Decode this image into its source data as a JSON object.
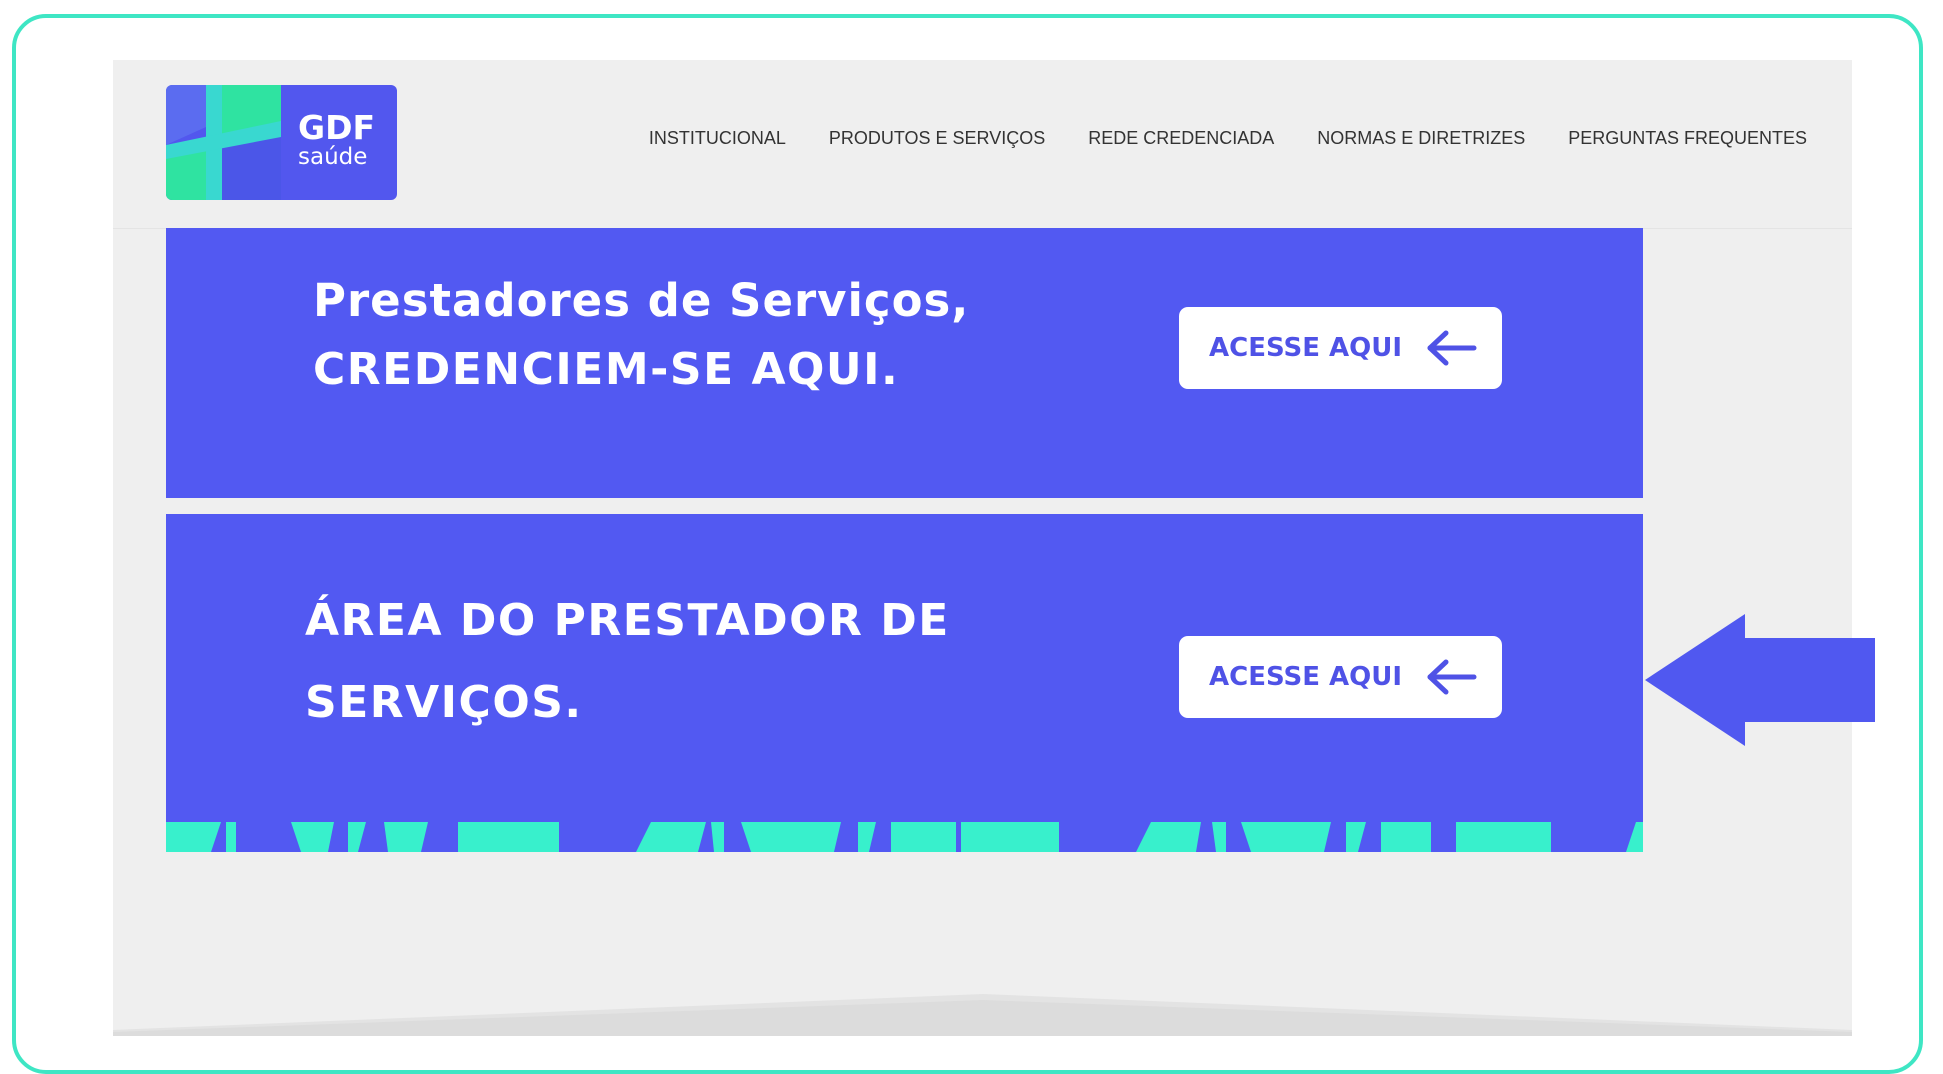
{
  "colors": {
    "frame_border": "#3ee6c4",
    "brand_blue": "#5259f2",
    "accent_teal": "#38f0cc",
    "page_bg": "#efefef"
  },
  "logo": {
    "word": "GDF",
    "sub": "saúde"
  },
  "nav": {
    "items": [
      "INSTITUCIONAL",
      "PRODUTOS E SERVIÇOS",
      "REDE CREDENCIADA",
      "NORMAS E DIRETRIZES",
      "PERGUNTAS FREQUENTES"
    ]
  },
  "banners": [
    {
      "title_line1": "Prestadores de Serviços,",
      "title_line2": "CREDENCIEM-SE AQUI.",
      "button_label": "ACESSE AQUI",
      "button_icon": "arrow-left-icon"
    },
    {
      "title_line1": "ÁREA DO PRESTADOR DE",
      "title_line2": "SERVIÇOS.",
      "button_label": "ACESSE AQUI",
      "button_icon": "arrow-left-icon"
    }
  ],
  "annotation": {
    "icon": "pointer-arrow-icon"
  }
}
